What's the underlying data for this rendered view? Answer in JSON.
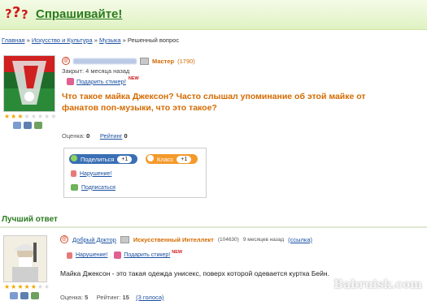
{
  "header": {
    "brand": "Спрашивайте!",
    "logo_marks": "???"
  },
  "breadcrumbs": [
    {
      "label": "Главная",
      "link": true
    },
    {
      "label": "Искусство и Культура",
      "link": true
    },
    {
      "label": "Музыка",
      "link": true
    },
    {
      "label": "Решенный вопрос",
      "link": false
    }
  ],
  "breadcrumb_sep": "»",
  "question": {
    "asker_rank": "Мастер",
    "asker_score": "(1790)",
    "closed_text": "Закрыт: 4 месяца назад",
    "gift_label": "Подарить стикер!",
    "new_badge": "NEW",
    "text": "Что такое майка Джексон? Часто слышал упоминание об этой майке от фанатов поп-музыки, что это такое?",
    "rating_label": "Оценка:",
    "rating_value": "0",
    "rank_label": "Рейтинг",
    "rank_value": "0",
    "stars_filled": 3,
    "stars_total": 8
  },
  "share": {
    "share_label": "Поделиться",
    "share_count": "+1",
    "class_label": "Класс",
    "class_count": "+1",
    "violation_label": "Нарушение!",
    "subscribe_label": "Подписаться"
  },
  "best_answer": {
    "title": "Лучший ответ",
    "author": "Добрый Доктор",
    "author_rank": "Искусственный Интеллект",
    "author_score": "(104630)",
    "time": "9 месяцев назад",
    "link_label": "(ссылка)",
    "violation_label": "Нарушение!",
    "gift_label": "Подарить стикер!",
    "new_badge": "NEW",
    "text": "Майка Джексон - это такая одежда унисекс, поверх которой одевается куртка Бейн.",
    "rating_label": "Оценка:",
    "rating_value": "5",
    "rank_label": "Рейтинг:",
    "rank_value": "15",
    "votes_label": "(3 голоса)",
    "stars_filled": 5,
    "stars_total": 7
  },
  "watermark": "Babruisk.com",
  "colors": {
    "accent_green": "#2a7a1e",
    "orange": "#d46a00",
    "link": "#1a4fa0"
  }
}
